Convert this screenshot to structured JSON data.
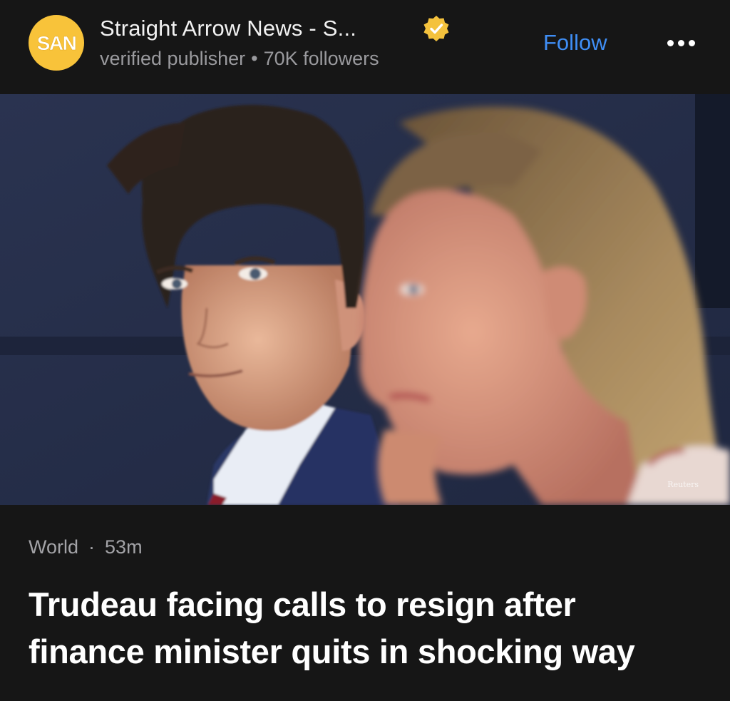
{
  "publisher": {
    "logo_text": "SAN",
    "name": "Straight Arrow News - S...",
    "verified_icon": "verified-badge-icon",
    "status": "verified publisher",
    "separator": "•",
    "followers": "70K followers"
  },
  "actions": {
    "follow_label": "Follow",
    "more_icon": "more-options-icon"
  },
  "image": {
    "credit": "Reuters"
  },
  "article": {
    "section": "World",
    "separator": "·",
    "age": "53m",
    "headline": "Trudeau facing calls to resign after finance minister quits in shocking way"
  },
  "colors": {
    "background": "#161616",
    "accent": "#3f8ef5",
    "logo_bg": "#f8c33a",
    "muted_text": "#9a9a9e"
  }
}
